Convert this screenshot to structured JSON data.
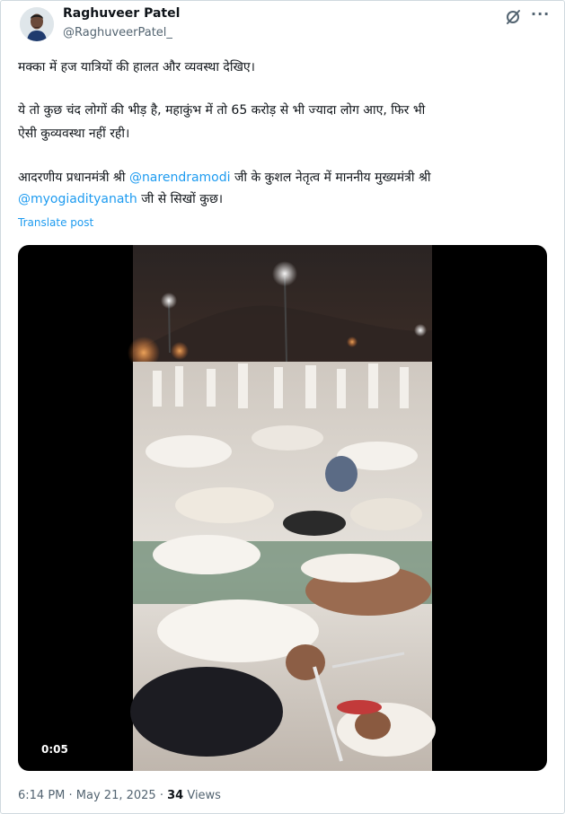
{
  "author": {
    "name": "Raghuveer Patel",
    "handle": "@RaghuveerPatel_"
  },
  "tweet": {
    "line1": "मक्का में हज यात्रियों की हालत और व्यवस्था देखिए।",
    "line2": "ये तो कुछ चंद लोगों की भीड़ है, महाकुंभ में तो 65 करोड़ से भी ज्यादा लोग आए, फिर भी",
    "line3": "ऐसी कुव्यवस्था नहीं रही।",
    "line4_prefix": "आदरणीय प्रधानमंत्री श्री ",
    "mention1": "@narendramodi",
    "line4_suffix": " जी के कुशल नेतृत्व में माननीय मुख्यमंत्री श्री",
    "mention2": "@myogiadityanath",
    "line5_suffix": " जी से सिखों कुछ।",
    "translate": "Translate post"
  },
  "video": {
    "timestamp": "0:05"
  },
  "meta": {
    "time": "6:14 PM",
    "sep1": " · ",
    "date": "May 21, 2025",
    "sep2": " · ",
    "views_count": "34",
    "views_label": " Views"
  },
  "icons": {
    "grok": "grok-slash-circle-icon",
    "more": "more-dots-icon"
  },
  "colors": {
    "link": "#1d9bf0",
    "text": "#0f1419",
    "muted": "#536471"
  }
}
